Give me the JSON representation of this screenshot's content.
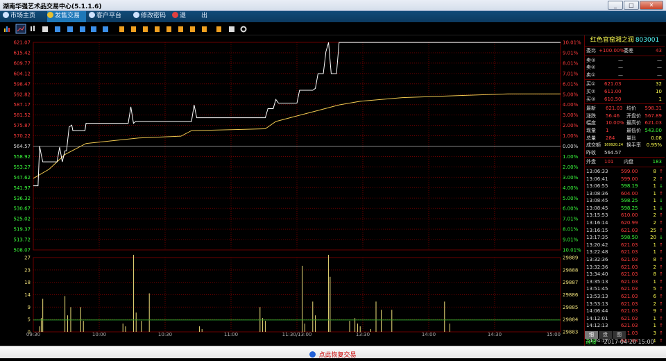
{
  "window": {
    "title": "湖南华强艺术品交易中心(5.1.1.6)",
    "minimize": "_",
    "maximize": "□",
    "close": "✕"
  },
  "menu": [
    {
      "label": "市场主页",
      "icon": "globe-icon"
    },
    {
      "label": "发售交易",
      "icon": "yen-icon"
    },
    {
      "label": "客户平台",
      "icon": "globe-icon"
    },
    {
      "label": "修改密码",
      "icon": "key-icon"
    },
    {
      "label": "退",
      "icon": "exit-icon"
    },
    {
      "label": "出",
      "icon": ""
    }
  ],
  "colors": {
    "up": "#ff3c3c",
    "down": "#3cff3c",
    "grid": "#6b0000",
    "price_line": "#ffffff",
    "avg_line": "#f0c850",
    "volume": "#f0e07a",
    "titlebar": "#d9e2ee"
  },
  "price_axis": {
    "left": [
      "621.07",
      "615.42",
      "609.77",
      "604.12",
      "598.47",
      "592.82",
      "587.17",
      "581.52",
      "575.87",
      "570.22",
      "564.57",
      "558.92",
      "553.27",
      "547.62",
      "541.97",
      "536.32",
      "530.67",
      "525.02",
      "519.37",
      "513.72",
      "508.07"
    ],
    "right": [
      "10.01%",
      "9.01%",
      "8.01%",
      "7.01%",
      "6.01%",
      "5.00%",
      "4.00%",
      "3.00%",
      "2.00%",
      "1.00%",
      "0.00%",
      "1.00%",
      "2.00%",
      "3.00%",
      "4.00%",
      "5.00%",
      "6.00%",
      "7.01%",
      "8.01%",
      "9.01%",
      "10.01%"
    ]
  },
  "volume_axis": {
    "left": [
      "27",
      "23",
      "18",
      "14",
      "9",
      "5",
      "0"
    ],
    "right": [
      "29889",
      "29888",
      "29887",
      "29886",
      "29885",
      "29884",
      "29883"
    ]
  },
  "time_axis": [
    "09:30",
    "10:00",
    "10:30",
    "11:00",
    "11:30/13:00",
    "13:30",
    "14:00",
    "14:30",
    "15:00"
  ],
  "panel": {
    "name": "红色官窑湘之润",
    "code": "803001",
    "ratio_label": "委比",
    "ratio_value": "+100.00%",
    "diff_label": "委差",
    "diff_value": "43",
    "asks": [
      {
        "label": "卖③",
        "price": "—",
        "vol": "—"
      },
      {
        "label": "卖②",
        "price": "—",
        "vol": "—"
      },
      {
        "label": "卖①",
        "price": "—",
        "vol": "—"
      }
    ],
    "bids": [
      {
        "label": "买①",
        "price": "621.03",
        "vol": "32"
      },
      {
        "label": "买②",
        "price": "611.00",
        "vol": "10"
      },
      {
        "label": "买③",
        "price": "610.50",
        "vol": "1"
      }
    ],
    "stats": [
      {
        "l1": "最新",
        "v1": "621.03",
        "l2": "均价",
        "v2": "598.31"
      },
      {
        "l1": "涨跌",
        "v1": "56.46",
        "l2": "开盘价",
        "v2": "567.89"
      },
      {
        "l1": "幅度",
        "v1": "10.00%",
        "l2": "最高价",
        "v2": "621.03"
      },
      {
        "l1": "现量",
        "v1": "1",
        "l2": "最低价",
        "v2": "543.00"
      },
      {
        "l1": "总量",
        "v1": "284",
        "l2": "量比",
        "v2": "0.08"
      },
      {
        "l1": "成交额",
        "v1": "169920.24",
        "l2": "换手率",
        "v2": "0.95%"
      }
    ],
    "prev_label": "昨收",
    "prev_value": "564.57",
    "outer_label": "外盘",
    "outer_value": "101",
    "inner_label": "内盘",
    "inner_value": "183",
    "ticks": [
      {
        "t": "13:06:33",
        "p": "599.00",
        "v": "8",
        "d": "↑"
      },
      {
        "t": "13:06:41",
        "p": "599.00",
        "v": "2",
        "d": "↑"
      },
      {
        "t": "13:06:55",
        "p": "598.19",
        "v": "1",
        "d": "↓"
      },
      {
        "t": "13:08:36",
        "p": "604.00",
        "v": "1",
        "d": "↑"
      },
      {
        "t": "13:08:45",
        "p": "598.25",
        "v": "1",
        "d": "↓"
      },
      {
        "t": "13:08:45",
        "p": "598.25",
        "v": "1",
        "d": "↓"
      },
      {
        "t": "13:15:53",
        "p": "610.00",
        "v": "2",
        "d": "↑"
      },
      {
        "t": "13:16:14",
        "p": "620.99",
        "v": "2",
        "d": "↑"
      },
      {
        "t": "13:16:15",
        "p": "621.03",
        "v": "25",
        "d": "↑"
      },
      {
        "t": "13:17:35",
        "p": "598.50",
        "v": "20",
        "d": "↓"
      },
      {
        "t": "13:20:42",
        "p": "621.03",
        "v": "1",
        "d": "↑"
      },
      {
        "t": "13:22:48",
        "p": "621.03",
        "v": "1",
        "d": "↑"
      },
      {
        "t": "13:32:36",
        "p": "621.03",
        "v": "8",
        "d": "↑"
      },
      {
        "t": "13:32:36",
        "p": "621.03",
        "v": "2",
        "d": "↑"
      },
      {
        "t": "13:34:40",
        "p": "621.03",
        "v": "8",
        "d": "↑"
      },
      {
        "t": "13:35:13",
        "p": "621.03",
        "v": "1",
        "d": "↑"
      },
      {
        "t": "13:51:45",
        "p": "621.03",
        "v": "5",
        "d": "↑"
      },
      {
        "t": "13:53:13",
        "p": "621.03",
        "v": "6",
        "d": "↑"
      },
      {
        "t": "13:53:13",
        "p": "621.03",
        "v": "2",
        "d": "↑"
      },
      {
        "t": "14:06:44",
        "p": "621.03",
        "v": "9",
        "d": "↑"
      },
      {
        "t": "14:12:01",
        "p": "621.03",
        "v": "1",
        "d": "↑"
      },
      {
        "t": "14:12:13",
        "p": "621.03",
        "v": "1",
        "d": "↑"
      },
      {
        "t": "14:21:14",
        "p": "621.03",
        "v": "3",
        "d": "↑"
      },
      {
        "t": "14:24:17",
        "p": "621.03",
        "v": "1",
        "d": "↑"
      }
    ],
    "tabs": [
      "细",
      "盘",
      "图"
    ]
  },
  "status": {
    "connection": "连接",
    "datetime": "2017-04-20 15:00"
  },
  "bottom": {
    "resume_label": "点此恢复交易"
  },
  "chart_data": {
    "type": "line",
    "prev_close": 564.57,
    "ylim": [
      508.07,
      621.07
    ],
    "x": [
      "09:30",
      "10:00",
      "10:30",
      "11:00",
      "11:30/13:00",
      "13:30",
      "14:00",
      "14:30",
      "15:00"
    ],
    "series": [],
    "price": [
      [
        0,
        543
      ],
      [
        0.003,
        543
      ],
      [
        0.006,
        543
      ],
      [
        0.009,
        543
      ],
      [
        0.012,
        564.6
      ],
      [
        0.015,
        560
      ],
      [
        0.018,
        556
      ],
      [
        0.03,
        556
      ],
      [
        0.045,
        556
      ],
      [
        0.05,
        564
      ],
      [
        0.055,
        556
      ],
      [
        0.06,
        562
      ],
      [
        0.063,
        562
      ],
      [
        0.068,
        575
      ],
      [
        0.073,
        576
      ],
      [
        0.075,
        573
      ],
      [
        0.095,
        573
      ],
      [
        0.098,
        573
      ],
      [
        0.1,
        577
      ],
      [
        0.115,
        577
      ],
      [
        0.12,
        577
      ],
      [
        0.18,
        577
      ],
      [
        0.185,
        586
      ],
      [
        0.19,
        577
      ],
      [
        0.194,
        578
      ],
      [
        0.28,
        578
      ],
      [
        0.3,
        578
      ],
      [
        0.305,
        587
      ],
      [
        0.31,
        580
      ],
      [
        0.4,
        580
      ],
      [
        0.43,
        580
      ],
      [
        0.44,
        580
      ],
      [
        0.445,
        585
      ],
      [
        0.455,
        585
      ],
      [
        0.46,
        590
      ],
      [
        0.465,
        588
      ],
      [
        0.49,
        588
      ],
      [
        0.5,
        588
      ],
      [
        0.505,
        595
      ],
      [
        0.52,
        595
      ],
      [
        0.53,
        595
      ],
      [
        0.535,
        596
      ],
      [
        0.54,
        604
      ],
      [
        0.55,
        604
      ],
      [
        0.555,
        616
      ],
      [
        0.56,
        621
      ],
      [
        0.565,
        604
      ],
      [
        0.575,
        604
      ],
      [
        0.58,
        621
      ],
      [
        1,
        621
      ]
    ],
    "avg": [
      [
        0,
        547
      ],
      [
        0.03,
        552
      ],
      [
        0.06,
        560
      ],
      [
        0.1,
        566
      ],
      [
        0.2,
        569
      ],
      [
        0.28,
        570
      ],
      [
        0.3,
        573
      ],
      [
        0.44,
        574
      ],
      [
        0.46,
        578
      ],
      [
        0.5,
        581
      ],
      [
        0.54,
        584
      ],
      [
        0.58,
        587
      ],
      [
        0.62,
        589
      ],
      [
        0.7,
        591
      ],
      [
        0.8,
        592
      ],
      [
        0.9,
        593
      ],
      [
        1,
        593
      ]
    ],
    "volume": [
      [
        0.012,
        2
      ],
      [
        0.015,
        5
      ],
      [
        0.018,
        12
      ],
      [
        0.06,
        13
      ],
      [
        0.065,
        6
      ],
      [
        0.071,
        9
      ],
      [
        0.09,
        9
      ],
      [
        0.095,
        4
      ],
      [
        0.17,
        3
      ],
      [
        0.175,
        2
      ],
      [
        0.19,
        28
      ],
      [
        0.195,
        7
      ],
      [
        0.205,
        4
      ],
      [
        0.22,
        14
      ],
      [
        0.315,
        2
      ],
      [
        0.32,
        1
      ],
      [
        0.43,
        9
      ],
      [
        0.435,
        5
      ],
      [
        0.44,
        4
      ],
      [
        0.51,
        24
      ],
      [
        0.515,
        3
      ],
      [
        0.53,
        11
      ],
      [
        0.535,
        6
      ],
      [
        0.56,
        28
      ],
      [
        0.563,
        20
      ],
      [
        0.6,
        4
      ],
      [
        0.61,
        5
      ],
      [
        0.615,
        3
      ],
      [
        0.62,
        2
      ],
      [
        0.64,
        1
      ],
      [
        0.65,
        11
      ],
      [
        0.66,
        8
      ],
      [
        0.68,
        8
      ],
      [
        0.78,
        11
      ],
      [
        0.79,
        3
      ]
    ],
    "volume_ylim": [
      0,
      27
    ]
  }
}
